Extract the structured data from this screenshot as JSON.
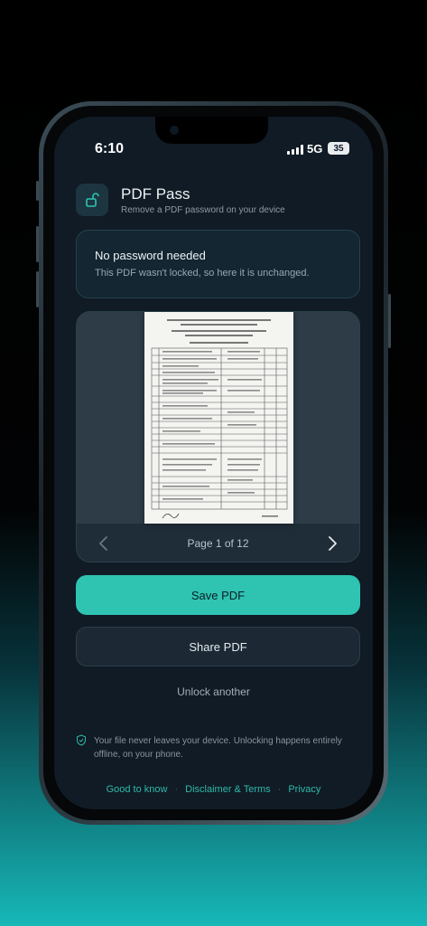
{
  "status_bar": {
    "time": "6:10",
    "network": "5G",
    "battery": "35"
  },
  "header": {
    "title": "PDF Pass",
    "subtitle": "Remove a PDF password on your device",
    "icon": "unlock-icon"
  },
  "notice": {
    "title": "No password needed",
    "text": "This PDF wasn't locked, so here it is unchanged."
  },
  "preview": {
    "page_label": "Page 1 of 12",
    "current_page": 1,
    "total_pages": 12
  },
  "actions": {
    "save_label": "Save PDF",
    "share_label": "Share PDF",
    "unlock_another_label": "Unlock another"
  },
  "privacy_note": "Your file never leaves your device. Unlocking happens entirely offline, on your phone.",
  "footer": {
    "links": [
      "Good to know",
      "Disclaimer & Terms",
      "Privacy"
    ],
    "separator": "·"
  },
  "colors": {
    "accent": "#2fc3b2",
    "background": "#101b25",
    "card_border": "#28424c",
    "link": "#2fb9aa"
  }
}
